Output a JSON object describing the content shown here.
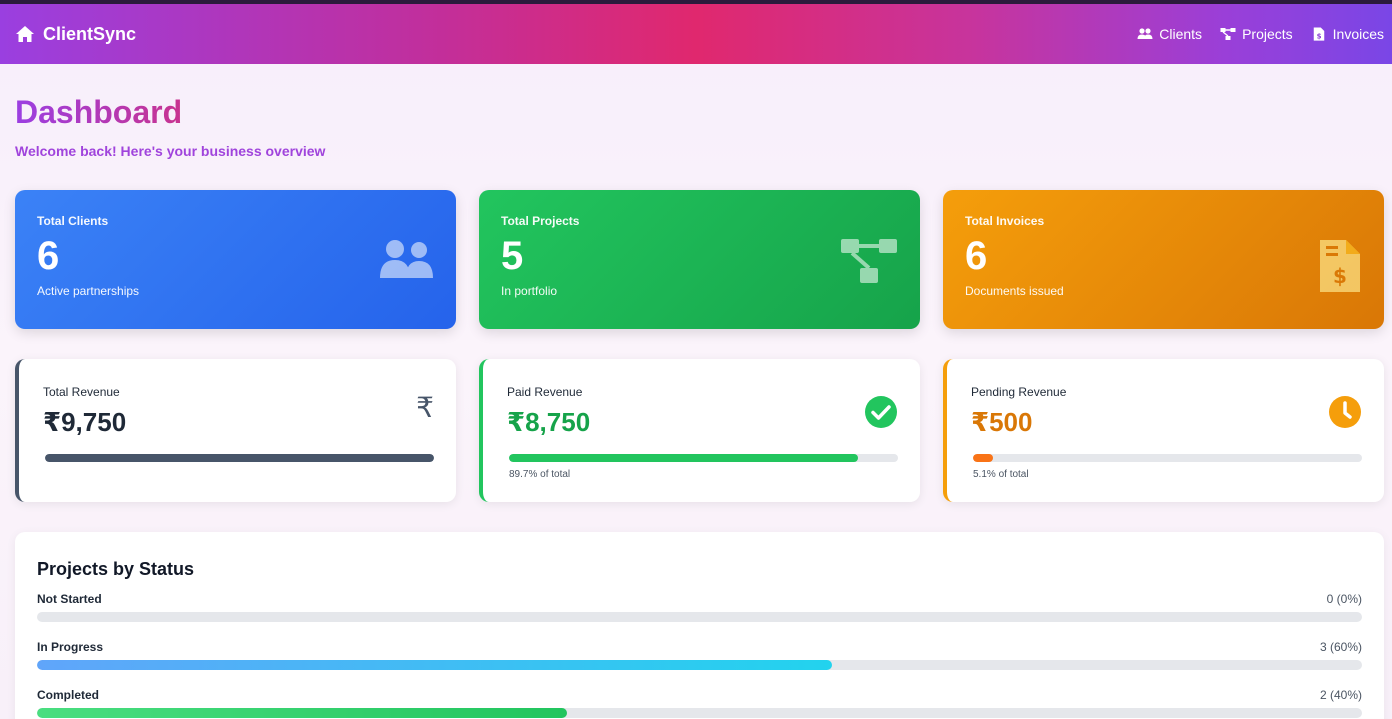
{
  "app": {
    "brand": "ClientSync"
  },
  "nav": [
    {
      "label": "Clients",
      "icon": "users-icon"
    },
    {
      "label": "Projects",
      "icon": "sitemap-icon"
    },
    {
      "label": "Invoices",
      "icon": "invoice-icon"
    }
  ],
  "header": {
    "title": "Dashboard",
    "subtitle": "Welcome back! Here's your business overview"
  },
  "stats": [
    {
      "label": "Total Clients",
      "value": "6",
      "sub": "Active partnerships",
      "icon": "users-icon",
      "color": "#3b82f6"
    },
    {
      "label": "Total Projects",
      "value": "5",
      "sub": "In portfolio",
      "icon": "sitemap-icon",
      "color": "#22c55e"
    },
    {
      "label": "Total Invoices",
      "value": "6",
      "sub": "Documents issued",
      "icon": "invoice-dollar-icon",
      "color": "#f59e0b"
    }
  ],
  "revenue": [
    {
      "label": "Total Revenue",
      "value": "₹9,750",
      "progress": 100,
      "pct_text": "",
      "icon": "rupee-icon",
      "color": "#475569"
    },
    {
      "label": "Paid Revenue",
      "value": "₹8,750",
      "progress": 89.7,
      "pct_text": "89.7% of total",
      "icon": "check-circle-icon",
      "color": "#22c55e"
    },
    {
      "label": "Pending Revenue",
      "value": "₹500",
      "progress": 5.1,
      "pct_text": "5.1% of total",
      "icon": "clock-icon",
      "color": "#f59e0b"
    }
  ],
  "status_panel": {
    "title": "Projects by Status",
    "rows": [
      {
        "label": "Not Started",
        "count_text": "0 (0%)",
        "percent": 0
      },
      {
        "label": "In Progress",
        "count_text": "3 (60%)",
        "percent": 60
      },
      {
        "label": "Completed",
        "count_text": "2 (40%)",
        "percent": 40
      }
    ]
  }
}
